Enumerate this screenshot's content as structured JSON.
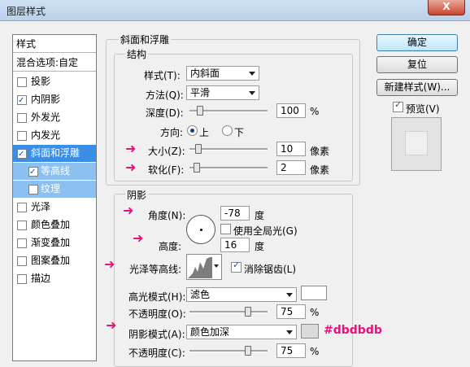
{
  "window": {
    "title": "图层样式",
    "close_label": "X"
  },
  "style_list": {
    "header": "样式",
    "blend_options": "混合选项:自定",
    "items": [
      {
        "label": "投影",
        "checked": false
      },
      {
        "label": "内阴影",
        "checked": true
      },
      {
        "label": "外发光",
        "checked": false
      },
      {
        "label": "内发光",
        "checked": false
      },
      {
        "label": "斜面和浮雕",
        "checked": true,
        "selected": true
      },
      {
        "label": "等高线",
        "checked": true,
        "sub": true
      },
      {
        "label": "纹理",
        "checked": false,
        "sub": true
      },
      {
        "label": "光泽",
        "checked": false
      },
      {
        "label": "颜色叠加",
        "checked": false
      },
      {
        "label": "渐变叠加",
        "checked": false
      },
      {
        "label": "图案叠加",
        "checked": false
      },
      {
        "label": "描边",
        "checked": false
      }
    ]
  },
  "bevel": {
    "section_title": "斜面和浮雕",
    "structure_title": "结构",
    "style_label": "样式(T):",
    "style_value": "内斜面",
    "technique_label": "方法(Q):",
    "technique_value": "平滑",
    "depth_label": "深度(D):",
    "depth_value": "100",
    "depth_unit": "%",
    "depth_level": 0.1,
    "direction_label": "方向:",
    "direction_up": "上",
    "direction_down": "下",
    "direction_selected": "上",
    "size_label": "大小(Z):",
    "size_value": "10",
    "size_unit": "像素",
    "size_level": 0.08,
    "soften_label": "软化(F):",
    "soften_value": "2",
    "soften_unit": "像素",
    "soften_level": 0.05
  },
  "shading": {
    "title": "阴影",
    "angle_label": "角度(N):",
    "angle_value": "-78",
    "angle_unit": "度",
    "global_light_label": "使用全局光(G)",
    "global_light_checked": false,
    "altitude_label": "高度:",
    "altitude_value": "16",
    "altitude_unit": "度",
    "gloss_contour_label": "光泽等高线:",
    "anti_alias_label": "消除锯齿(L)",
    "anti_alias_checked": true,
    "highlight_mode_label": "高光模式(H):",
    "highlight_mode_value": "滤色",
    "highlight_color": "#ffffff",
    "highlight_opacity_label": "不透明度(O):",
    "highlight_opacity_value": "75",
    "highlight_opacity_unit": "%",
    "highlight_opacity_level": 0.75,
    "shadow_mode_label": "阴影模式(A):",
    "shadow_mode_value": "颜色加深",
    "shadow_color": "#dbdbdb",
    "shadow_color_note": "#dbdbdb",
    "shadow_opacity_label": "不透明度(C):",
    "shadow_opacity_value": "75",
    "shadow_opacity_unit": "%",
    "shadow_opacity_level": 0.75
  },
  "buttons": {
    "ok": "确定",
    "reset": "复位",
    "new_style": "新建样式(W)...",
    "preview": "预览(V)",
    "preview_checked": true
  },
  "colors": {
    "accent": "#3a8ee6",
    "annotation": "#e8127c"
  }
}
